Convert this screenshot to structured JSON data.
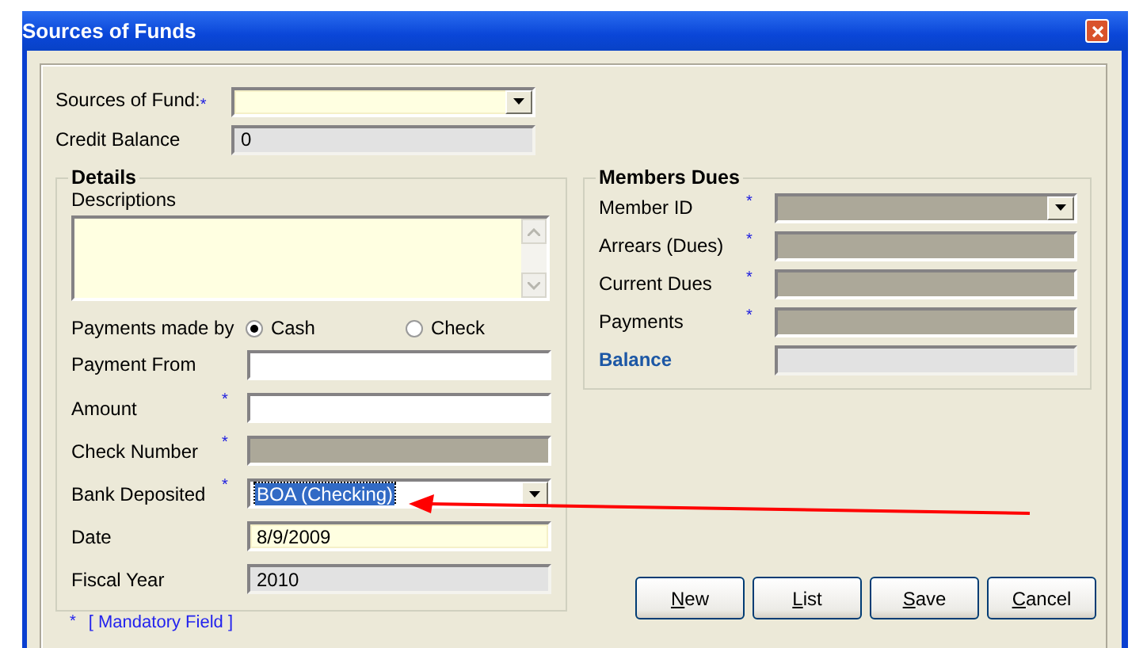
{
  "window": {
    "title": "Sources of Funds"
  },
  "header_fields": [
    {
      "label": "Sources of Fund:",
      "marker": "*",
      "kind": "dropdown",
      "highlighted": true,
      "disabled": false,
      "read_only": false
    },
    {
      "label": "Credit Balance",
      "kind": "text",
      "highlighted": false,
      "disabled": false,
      "read_only": true,
      "value": "0"
    }
  ],
  "details": {
    "title": "Details",
    "description_label": "Descriptions",
    "payment_method": {
      "label": "Payments made by",
      "options": [
        {
          "label": "Cash",
          "selected": true
        },
        {
          "label": "Check",
          "selected": false
        }
      ]
    },
    "fields": [
      {
        "label": "Payment From",
        "kind": "text",
        "highlighted": false,
        "disabled": false,
        "read_only": false
      },
      {
        "label": "Amount",
        "marker": "*",
        "kind": "text",
        "highlighted": false,
        "disabled": false,
        "read_only": false
      },
      {
        "label": "Check Number",
        "marker": "*",
        "kind": "text",
        "highlighted": false,
        "disabled": true,
        "read_only": false
      },
      {
        "label": "Bank Deposited",
        "marker": "*",
        "kind": "dropdown",
        "highlighted": false,
        "disabled": false,
        "read_only": false,
        "value": "BOA (Checking)",
        "selected": true
      },
      {
        "label": "Date",
        "kind": "text",
        "highlighted": true,
        "disabled": false,
        "read_only": false,
        "value": "8/9/2009"
      },
      {
        "label": "Fiscal Year",
        "kind": "text",
        "highlighted": false,
        "disabled": false,
        "read_only": true,
        "value": "2010"
      }
    ]
  },
  "members_dues": {
    "title": "Members Dues",
    "fields": [
      {
        "label": "Member ID",
        "marker": "*",
        "kind": "dropdown",
        "highlighted": false,
        "disabled": true,
        "read_only": false
      },
      {
        "label": "Arrears (Dues)",
        "marker": "*",
        "kind": "text",
        "highlighted": false,
        "disabled": true,
        "read_only": false
      },
      {
        "label": "Current Dues",
        "marker": "*",
        "kind": "text",
        "highlighted": false,
        "disabled": true,
        "read_only": false
      },
      {
        "label": "Payments",
        "marker": "*",
        "kind": "text",
        "highlighted": false,
        "disabled": true,
        "read_only": false
      },
      {
        "label": "Balance",
        "kind": "text",
        "highlighted": false,
        "disabled": false,
        "read_only": true,
        "emphasis": true
      }
    ]
  },
  "buttons": [
    "New",
    "List",
    "Save",
    "Cancel"
  ],
  "footnote": {
    "marker": "*",
    "text": "[ Mandatory Field ]"
  }
}
